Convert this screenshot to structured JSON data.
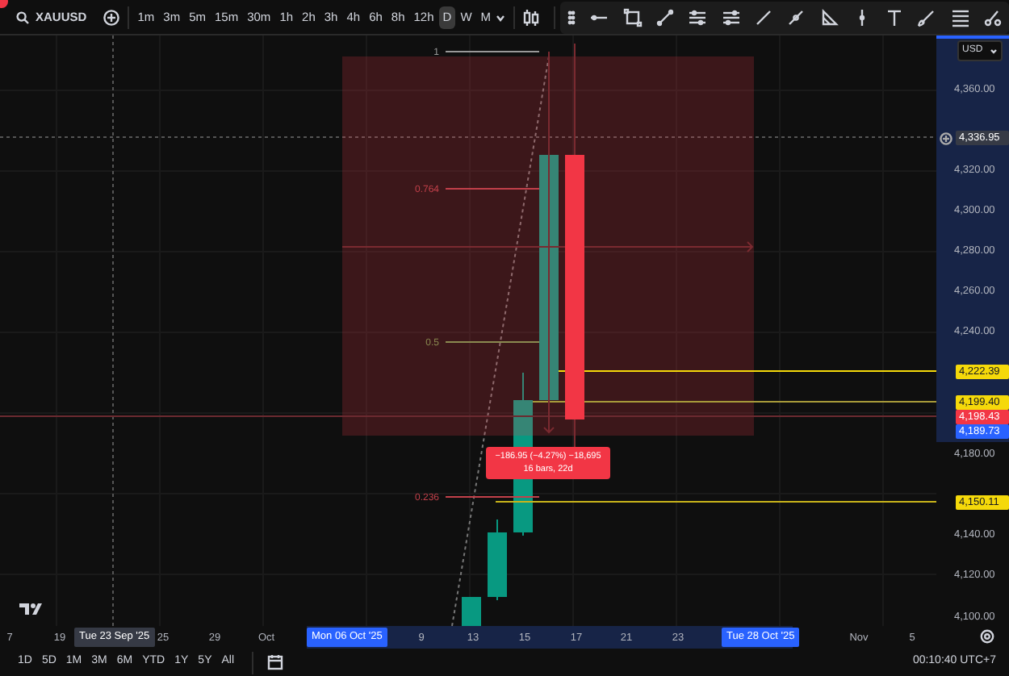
{
  "toolbar": {
    "symbol": "XAUUSD",
    "timeframes": [
      {
        "label": "1m",
        "selected": false
      },
      {
        "label": "3m",
        "selected": false
      },
      {
        "label": "5m",
        "selected": false
      },
      {
        "label": "15m",
        "selected": false
      },
      {
        "label": "30m",
        "selected": false
      },
      {
        "label": "1h",
        "selected": false
      },
      {
        "label": "2h",
        "selected": false
      },
      {
        "label": "3h",
        "selected": false
      },
      {
        "label": "4h",
        "selected": false
      },
      {
        "label": "6h",
        "selected": false
      },
      {
        "label": "8h",
        "selected": false
      },
      {
        "label": "12h",
        "selected": false
      },
      {
        "label": "D",
        "selected": true
      },
      {
        "label": "W",
        "selected": false
      },
      {
        "label": "M",
        "selected": false
      }
    ]
  },
  "chart": {
    "fib_levels": [
      {
        "label": "1",
        "kind": "grey"
      },
      {
        "label": "0.764",
        "kind": "red"
      },
      {
        "label": "0.5",
        "kind": "olive"
      },
      {
        "label": "0.236",
        "kind": "red"
      }
    ],
    "measure_tooltip": {
      "line_1": "−186.95 (−4.27%) −18,695",
      "line_2": "16 bars, 22d"
    }
  },
  "price_axis": {
    "currency": "USD",
    "ticks": [
      "4,360.00",
      "4,320.00",
      "4,300.00",
      "4,280.00",
      "4,260.00",
      "4,240.00",
      "4,180.00",
      "4,140.00",
      "4,120.00",
      "4,100.00"
    ],
    "markers": [
      {
        "label": "4,336.95",
        "kind": "crosshair"
      },
      {
        "label": "4,222.39",
        "kind": "line"
      },
      {
        "label": "4,199.40",
        "kind": "line"
      },
      {
        "label": "4,198.43",
        "kind": "last"
      },
      {
        "label": "4,189.73",
        "kind": "range"
      },
      {
        "label": "4,150.11",
        "kind": "line"
      }
    ]
  },
  "time_axis": [
    {
      "label": "7",
      "kind": "tick"
    },
    {
      "label": "19",
      "kind": "tick"
    },
    {
      "label": "Tue 23 Sep '25",
      "kind": "crosshair"
    },
    {
      "label": "25",
      "kind": "tick"
    },
    {
      "label": "29",
      "kind": "tick"
    },
    {
      "label": "Oct",
      "kind": "tick"
    },
    {
      "label": "Mon 06 Oct '25",
      "kind": "range"
    },
    {
      "label": "9",
      "kind": "tick"
    },
    {
      "label": "13",
      "kind": "tick"
    },
    {
      "label": "15",
      "kind": "tick"
    },
    {
      "label": "17",
      "kind": "tick"
    },
    {
      "label": "21",
      "kind": "tick"
    },
    {
      "label": "23",
      "kind": "tick"
    },
    {
      "label": "Tue 28 Oct '25",
      "kind": "range"
    },
    {
      "label": "Nov",
      "kind": "tick"
    },
    {
      "label": "5",
      "kind": "tick"
    }
  ],
  "bottom_bar": {
    "ranges": [
      "1D",
      "5D",
      "1M",
      "3M",
      "6M",
      "YTD",
      "1Y",
      "5Y",
      "All"
    ],
    "clock": "00:10:40 UTC+7"
  }
}
